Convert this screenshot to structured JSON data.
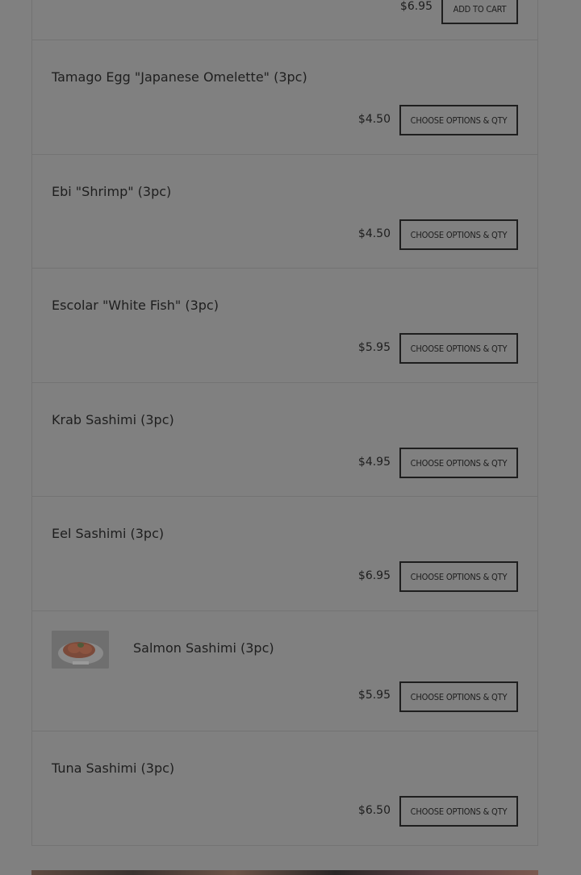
{
  "items": [
    {
      "name": "",
      "price": "$6.95",
      "button": "ADD TO CART"
    },
    {
      "name": "Tamago Egg \"Japanese Omelette\" (3pc)",
      "price": "$4.50",
      "button": "CHOOSE OPTIONS & QTY"
    },
    {
      "name": "Ebi \"Shrimp\" (3pc)",
      "price": "$4.50",
      "button": "CHOOSE OPTIONS & QTY"
    },
    {
      "name": "Escolar \"White Fish\" (3pc)",
      "price": "$5.95",
      "button": "CHOOSE OPTIONS & QTY"
    },
    {
      "name": "Krab Sashimi (3pc)",
      "price": "$4.95",
      "button": "CHOOSE OPTIONS & QTY"
    },
    {
      "name": "Eel Sashimi (3pc)",
      "price": "$6.95",
      "button": "CHOOSE OPTIONS & QTY"
    },
    {
      "name": "Salmon Sashimi (3pc)",
      "price": "$5.95",
      "button": "CHOOSE OPTIONS & QTY"
    },
    {
      "name": "Tuna Sashimi (3pc)",
      "price": "$6.50",
      "button": "CHOOSE OPTIONS & QTY"
    }
  ]
}
